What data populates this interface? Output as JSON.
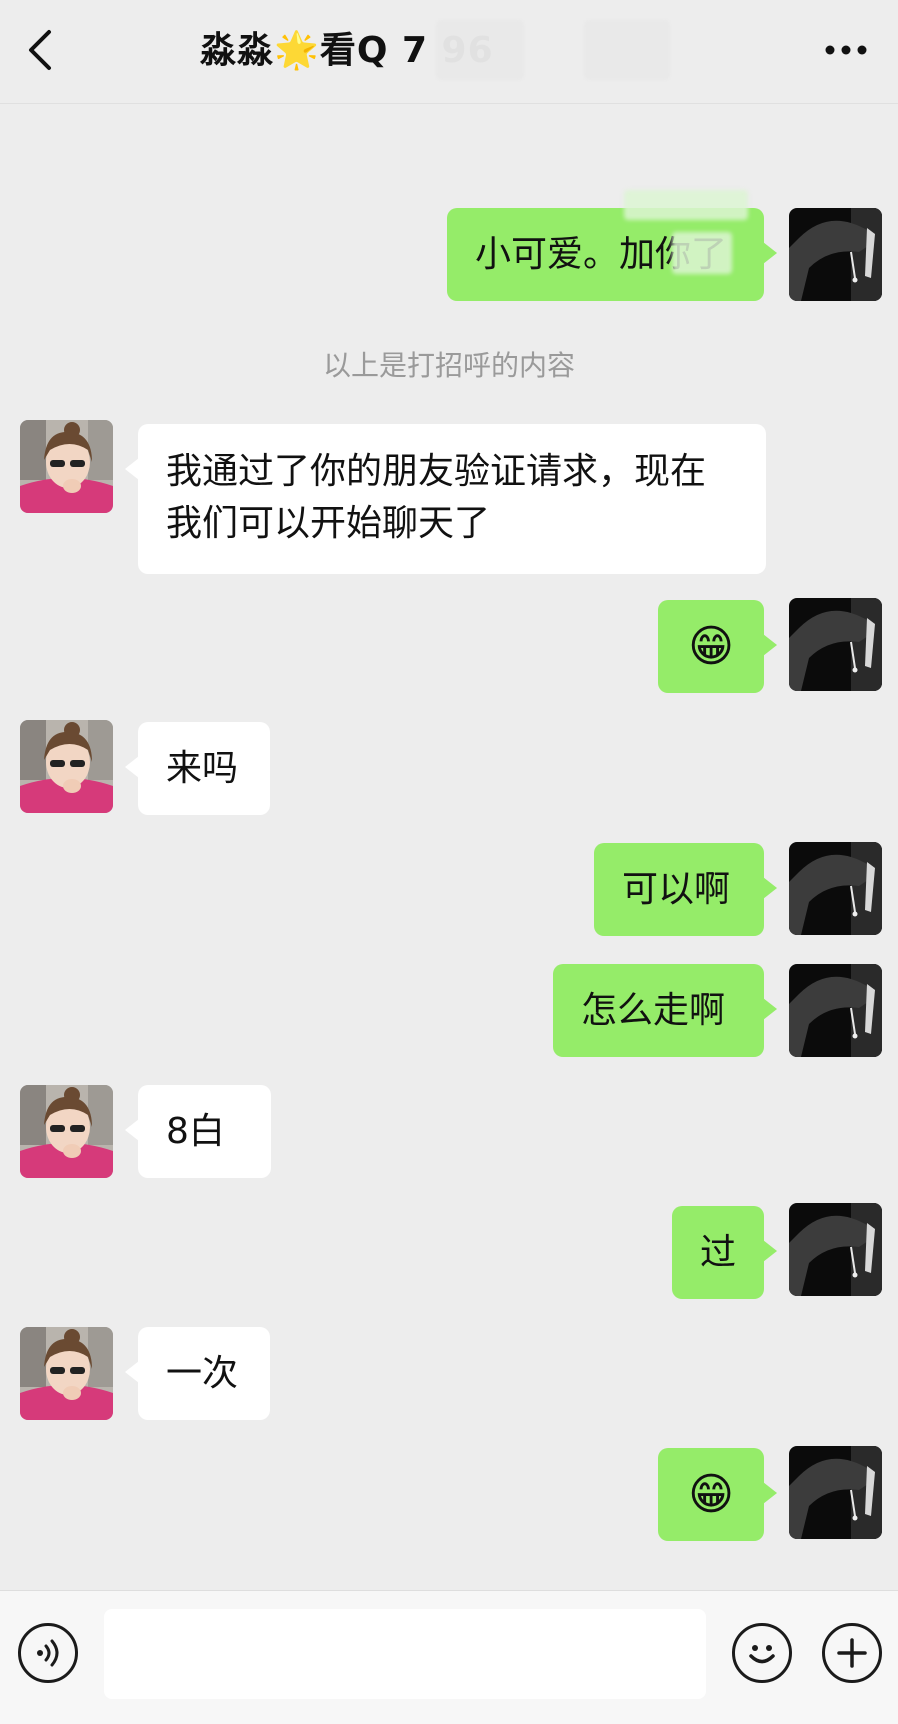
{
  "header": {
    "title": "淼淼🌟看Q        7      96",
    "back_icon": "chevron-left-icon",
    "more_icon": "more-dots-icon"
  },
  "system": {
    "greeting_note": "以上是打招呼的内容"
  },
  "messages": [
    {
      "from": "me",
      "text": "小可爱。加你了"
    },
    {
      "from": "them",
      "text": "我通过了你的朋友验证请求，现在我们可以开始聊天了"
    },
    {
      "from": "me",
      "text": "😁"
    },
    {
      "from": "them",
      "text": "来吗"
    },
    {
      "from": "me",
      "text": "可以啊"
    },
    {
      "from": "me",
      "text": "怎么走啊"
    },
    {
      "from": "them",
      "text": "8白"
    },
    {
      "from": "me",
      "text": "过"
    },
    {
      "from": "them",
      "text": "一次"
    },
    {
      "from": "me",
      "text": "😁"
    }
  ],
  "input_bar": {
    "placeholder": "",
    "voice_icon": "voice-icon",
    "emoji_icon": "emoji-icon",
    "plus_icon": "plus-icon"
  },
  "colors": {
    "background": "#ededed",
    "my_bubble": "#95ec69",
    "their_bubble": "#ffffff"
  }
}
